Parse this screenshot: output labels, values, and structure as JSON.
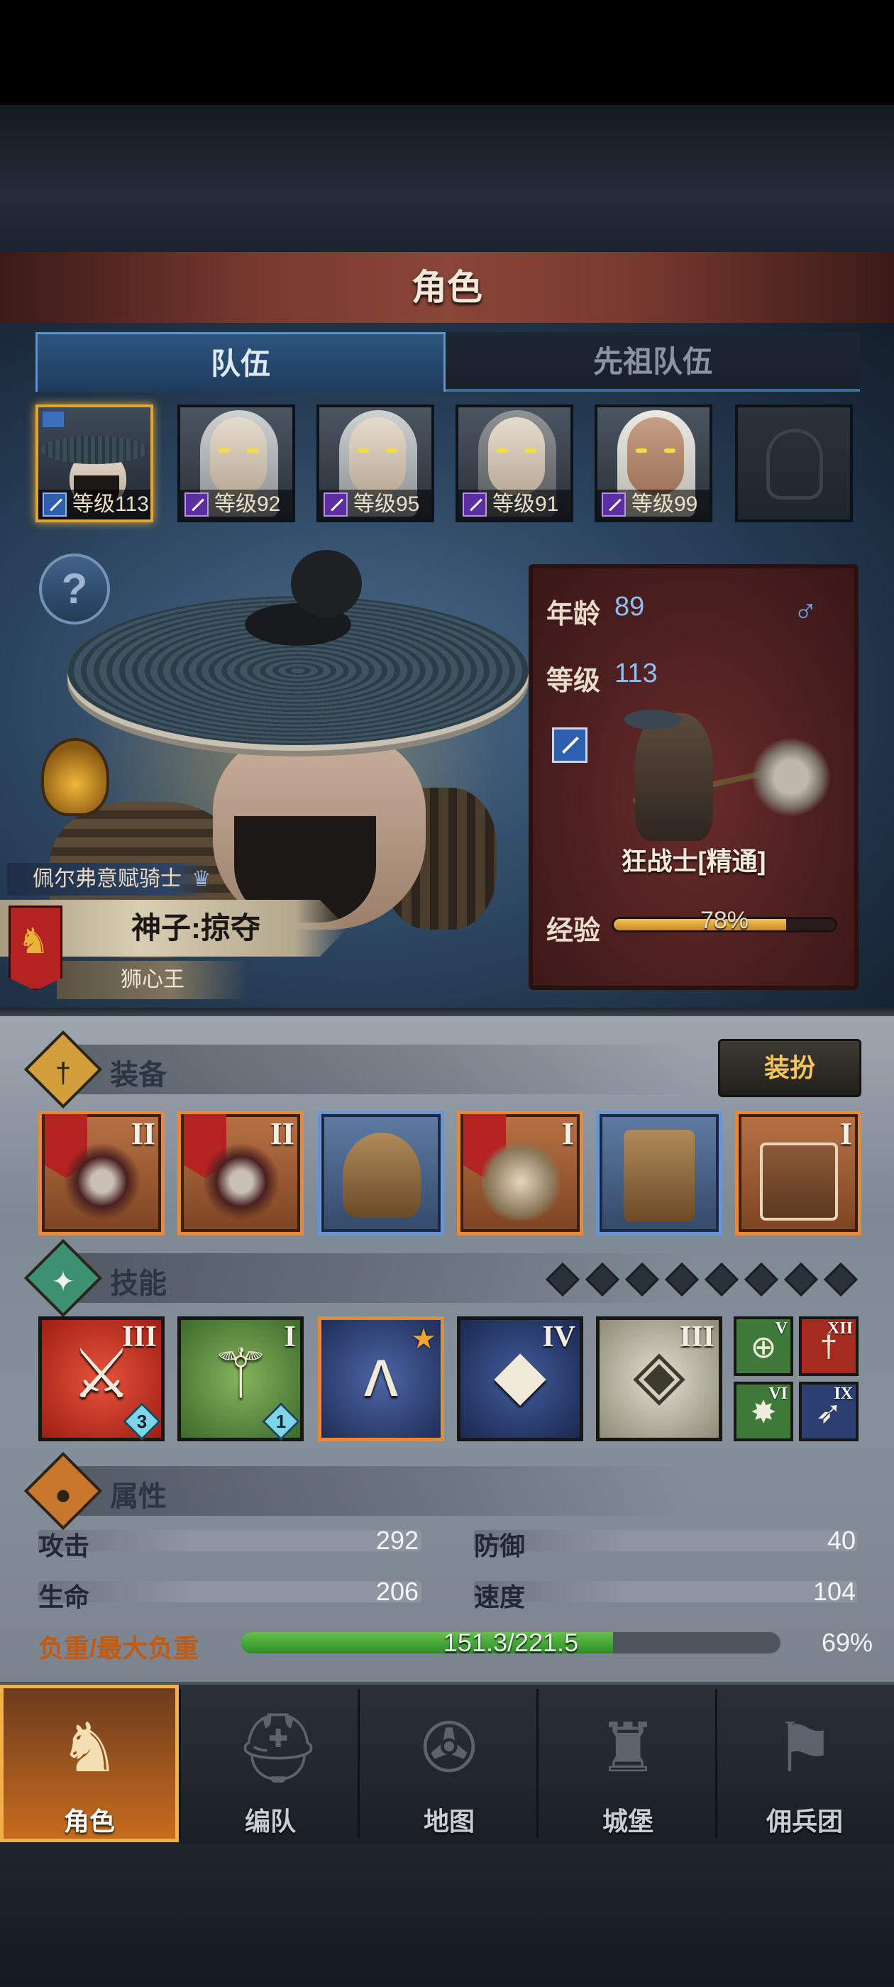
{
  "header": {
    "title": "角色"
  },
  "tabs": [
    {
      "label": "队伍",
      "active": true
    },
    {
      "label": "先祖队伍",
      "active": false
    }
  ],
  "party": [
    {
      "level_label": "等级113",
      "selected": true,
      "class_color": "blue"
    },
    {
      "level_label": "等级92",
      "selected": false,
      "class_color": "purple"
    },
    {
      "level_label": "等级95",
      "selected": false,
      "class_color": "purple"
    },
    {
      "level_label": "等级91",
      "selected": false,
      "class_color": "purple"
    },
    {
      "level_label": "等级99",
      "selected": false,
      "class_color": "purple"
    },
    {
      "level_label": "",
      "empty": true
    }
  ],
  "hero": {
    "origin": "佩尔弗意赋骑士",
    "name": "神子:掠夺",
    "title": "狮心王"
  },
  "info": {
    "age_label": "年龄",
    "age_value": "89",
    "gender_symbol": "♂",
    "level_label": "等级",
    "level_value": "113",
    "class_name": "狂战士[精通]",
    "exp_label": "经验",
    "exp_percent_text": "78%",
    "exp_fraction": 0.78
  },
  "equipment": {
    "title": "装备",
    "dress_button": "装扮",
    "slots": [
      {
        "rarity": "orange",
        "tier": "II",
        "flag": true,
        "icon": "spiked-axe-icon"
      },
      {
        "rarity": "orange",
        "tier": "II",
        "flag": true,
        "icon": "spiked-axe-icon"
      },
      {
        "rarity": "blue",
        "tier": "",
        "flag": false,
        "icon": "helmet-icon"
      },
      {
        "rarity": "orange",
        "tier": "I",
        "flag": true,
        "icon": "fur-armor-icon"
      },
      {
        "rarity": "blue",
        "tier": "",
        "flag": false,
        "icon": "boots-icon"
      },
      {
        "rarity": "orange",
        "tier": "I",
        "flag": false,
        "icon": "tome-icon"
      }
    ]
  },
  "skills": {
    "title": "技能",
    "slots_total": 8,
    "items": [
      {
        "style": "red",
        "tier": "III",
        "count": "3",
        "icon": "slash-sword-icon"
      },
      {
        "style": "green",
        "tier": "I",
        "count": "1",
        "icon": "wind-blade-icon"
      },
      {
        "style": "navy",
        "tier": "",
        "star": true,
        "icon": "claw-strike-icon"
      },
      {
        "style": "blue2",
        "tier": "IV",
        "icon": "crystal-sword-icon"
      },
      {
        "style": "cream",
        "tier": "III",
        "icon": "crystal-shield-icon"
      }
    ],
    "mini": [
      {
        "tier": "V",
        "color": "#3f7a3a",
        "icon": "target-icon"
      },
      {
        "tier": "XII",
        "color": "#a52a20",
        "icon": "dagger-icon"
      },
      {
        "tier": "VI",
        "color": "#3f7a3a",
        "icon": "burst-icon"
      },
      {
        "tier": "IX",
        "color": "#2b3f70",
        "icon": "eagle-icon"
      }
    ]
  },
  "attributes": {
    "title": "属性",
    "attack_label": "攻击",
    "attack": "292",
    "defense_label": "防御",
    "defense": "40",
    "hp_label": "生命",
    "hp": "206",
    "speed_label": "速度",
    "speed": "104",
    "load_label": "负重/最大负重",
    "load_text": "151.3/221.5",
    "load_percent": "69%",
    "load_fraction": 0.69
  },
  "nav": [
    {
      "label": "角色",
      "active": true,
      "icon": "knight-icon"
    },
    {
      "label": "编队",
      "active": false,
      "icon": "helmet-formation-icon"
    },
    {
      "label": "地图",
      "active": false,
      "icon": "compass-map-icon"
    },
    {
      "label": "城堡",
      "active": false,
      "icon": "castle-icon"
    },
    {
      "label": "佣兵团",
      "active": false,
      "icon": "mercenary-icon"
    }
  ],
  "colors": {
    "accent_gold": "#e0a534",
    "rarity_orange": "#e38a3d",
    "rarity_blue": "#6a94d2",
    "load_green": "#3fae33"
  }
}
